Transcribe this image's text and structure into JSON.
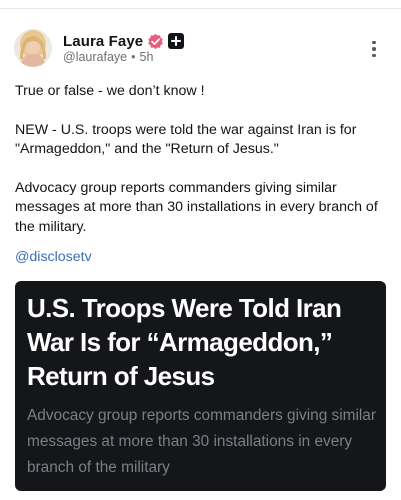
{
  "author": {
    "display_name": "Laura Faye",
    "handle": "@laurafaye",
    "separator": "•",
    "time_ago": "5h",
    "verified_color": "#e85d7a"
  },
  "post": {
    "paragraphs": [
      "True or false - we don’t know !",
      "NEW - U.S. troops were told the war against Iran is for \"Armageddon,\" and the \"Return of Jesus.\"",
      "Advocacy group reports commanders giving similar messages at more than 30 installations in every branch of the military."
    ],
    "mention": "@disclosetv"
  },
  "media_card": {
    "headline": "U.S. Troops Were Told Iran War Is for “Armageddon,” Return of Jesus",
    "subheadline": "Advocacy group reports commanders giving similar messages at more than 30 installations in every branch of the military",
    "background": "#141619"
  },
  "icons": {
    "verified": "verified-badge-icon",
    "plus": "plus-icon",
    "more": "more-vertical-icon"
  }
}
